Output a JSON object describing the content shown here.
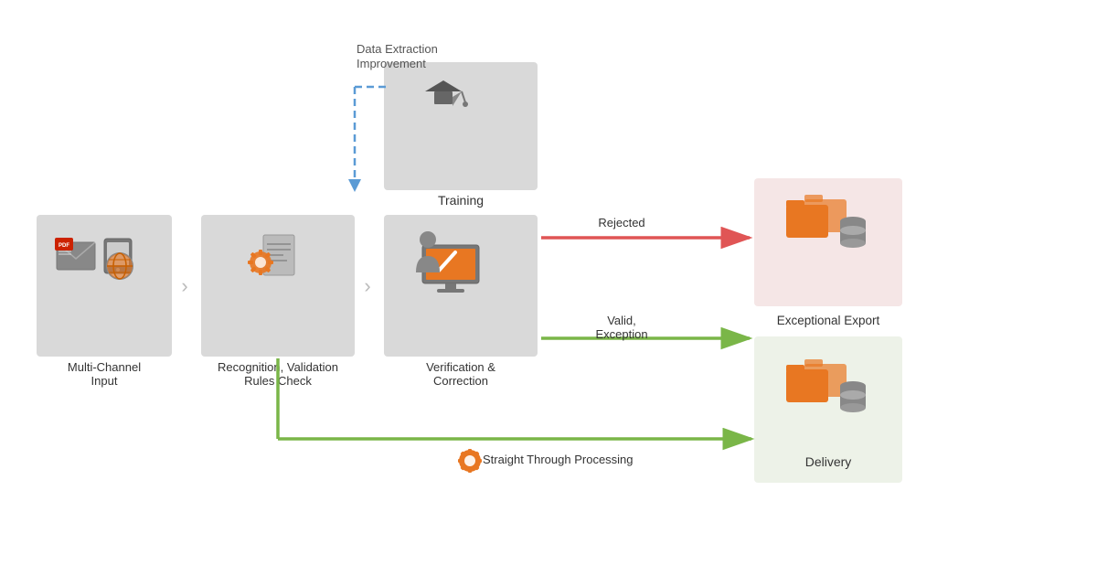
{
  "boxes": {
    "input": {
      "label": "Multi-Channel\nInput"
    },
    "recognition": {
      "label": "Recognition, Validation\nRules Check"
    },
    "verification": {
      "label": "Verification &\nCorrection"
    },
    "training": {
      "label": "Training"
    },
    "exceptional": {
      "label": "Exceptional Export"
    },
    "delivery": {
      "label": "Delivery"
    }
  },
  "arrows": {
    "rejected": "Rejected",
    "valid_exception": "Valid,\nException",
    "stp": "Straight Through Processing",
    "data_extraction": "Data Extraction\nImprovement"
  },
  "colors": {
    "box_gray": "#d9d9d9",
    "box_red": "#f5e6e6",
    "box_green": "#edf2e8",
    "arrow_red": "#e05555",
    "arrow_green": "#7ab648",
    "arrow_blue": "#5b9bd5",
    "orange": "#e87722"
  }
}
